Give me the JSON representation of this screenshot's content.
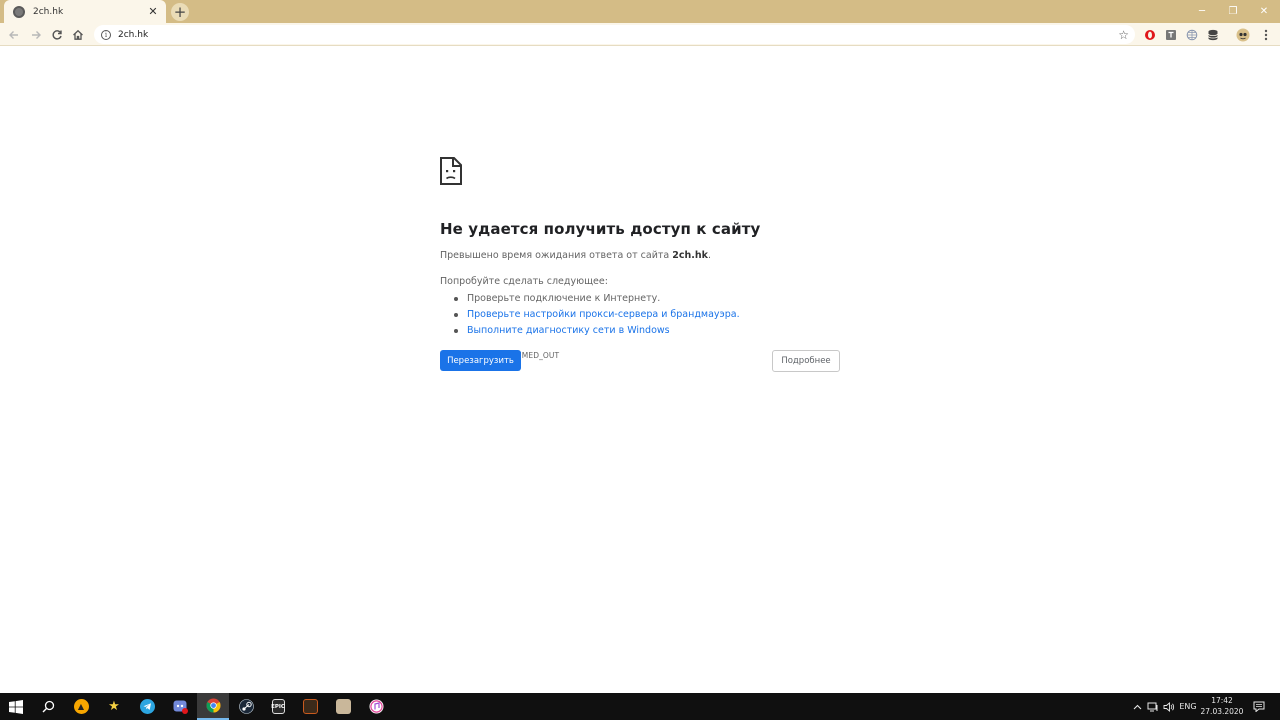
{
  "browser": {
    "tab_title": "2ch.hk",
    "tab_close": "✕",
    "new_tab": "+",
    "url": "2ch.hk",
    "window_controls": {
      "minimize": "─",
      "restore": "❐",
      "close": "✕"
    }
  },
  "error_page": {
    "title": "Не удается получить доступ к сайту",
    "summary_prefix": "Превышено время ожидания ответа от сайта ",
    "summary_host": "2ch.hk",
    "summary_suffix": ".",
    "suggestions_heading": "Попробуйте сделать следующее:",
    "suggestions": [
      {
        "text": "Проверьте подключение к Интернету.",
        "link": false
      },
      {
        "text": "Проверьте настройки прокси-сервера и брандмауэра.",
        "link": true
      },
      {
        "text": "Выполните диагностику сети в Windows",
        "link": true
      }
    ],
    "error_code": "ERR_CONNECTION_TIMED_OUT",
    "reload_button": "Перезагрузить",
    "details_button": "Подробнее"
  },
  "extensions": [
    "opera-icon",
    "translate-icon",
    "globe-icon",
    "database-icon",
    "profile-avatar-icon",
    "menu-icon"
  ],
  "taskbar": {
    "apps": [
      "start-icon",
      "search-icon",
      "avast-icon",
      "favorites-star-icon",
      "telegram-icon",
      "discord-icon",
      "chrome-icon",
      "steam-icon",
      "epic-games-icon",
      "game-icon",
      "game-icon-2",
      "itunes-icon"
    ],
    "epic_label": "EPIC",
    "tray_lang": "ENG",
    "time": "17:42",
    "date": "27.03.2020"
  },
  "colors": {
    "tabstrip": "#d4bc86",
    "toolbar": "#fbf6ea",
    "accent_blue": "#1a73e8",
    "taskbar": "#101010"
  }
}
